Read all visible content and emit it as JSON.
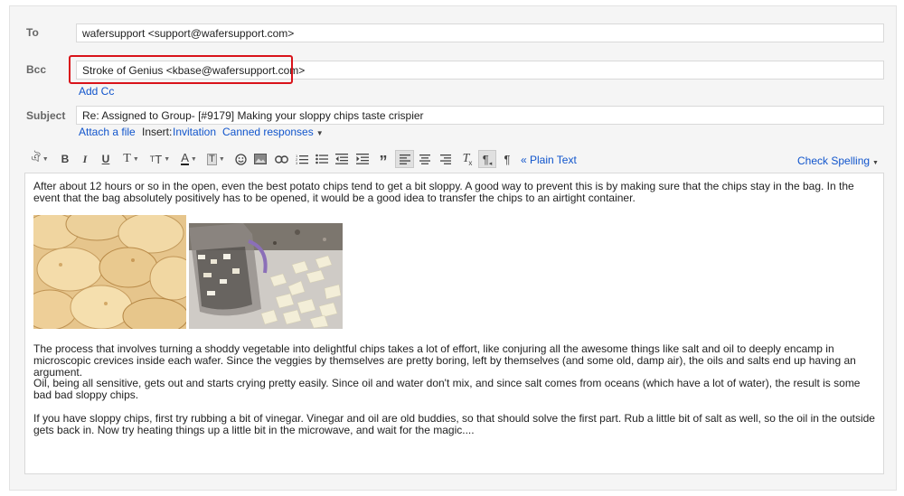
{
  "compose": {
    "to": {
      "label": "To",
      "value": "wafersupport <support@wafersupport.com>"
    },
    "bcc": {
      "label": "Bcc",
      "value": "Stroke of Genius <kbase@wafersupport.com>"
    },
    "add_cc": "Add Cc",
    "subject": {
      "label": "Subject",
      "value": "Re: Assigned to Group- [#9179] Making your sloppy chips taste crispier"
    },
    "attach_file": "Attach a file",
    "insert_label": "Insert:",
    "invitation": "Invitation",
    "canned_responses": "Canned responses"
  },
  "toolbar": {
    "bold": "B",
    "italic": "I",
    "underline": "U",
    "plain_text": "« Plain Text",
    "check_spelling": "Check Spelling",
    "icons": [
      "input-tools-icon",
      "bold-icon",
      "italic-icon",
      "underline-icon",
      "font-icon",
      "font-size-icon",
      "text-color-icon",
      "highlight-color-icon",
      "emoji-icon",
      "image-icon",
      "link-icon",
      "numbered-list-icon",
      "bulleted-list-icon",
      "indent-less-icon",
      "indent-more-icon",
      "quote-icon",
      "align-left-icon",
      "align-center-icon",
      "align-right-icon",
      "remove-formatting-icon",
      "rtl-icon",
      "ltr-icon"
    ]
  },
  "message": {
    "p1": "After about 12 hours or so in the open, even the best potato chips tend to get a bit sloppy. A good way to prevent this is by making sure that the chips stay in the bag. In the event that the bag absolutely positively has to be opened, it would be a good idea to transfer the chips to an airtight container.",
    "p2": "The process that involves turning a shoddy vegetable into delightful chips takes a lot of effort, like conjuring all the awesome things like salt and oil to deeply encamp in microscopic crevices inside each wafer. Since the veggies by themselves are pretty boring, left by themselves (and some old, damp air), the oils and salts end up having an argument.",
    "p3": "Oil, being all sensitive, gets out and starts crying pretty easily. Since oil and water don't mix, and since salt comes from oceans (which have a lot of water), the result is some bad bad sloppy chips.",
    "p4": "If you have sloppy chips, first try rubbing a bit of vinegar. Vinegar and oil are old buddies, so that should solve the first part. Rub a little bit of salt as well, so the oil in the outside gets back in. Now try heating things up a little bit in the microwave, and wait for the magic....",
    "images": [
      "potato-chips-photo",
      "chopped-chips-measuring-cup-photo"
    ]
  },
  "colors": {
    "link": "#1155cc",
    "highlight_border": "#d9131a",
    "panel_bg": "#f5f5f5"
  }
}
